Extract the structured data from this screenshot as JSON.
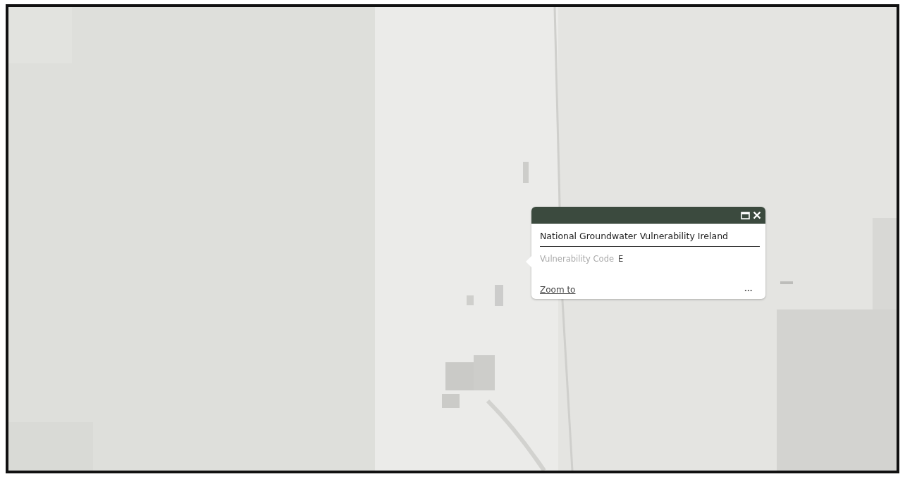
{
  "popup": {
    "title": "National Groundwater Vulnerability Ireland",
    "fields": [
      {
        "label": "Vulnerability Code",
        "value": "E"
      }
    ],
    "action": "Zoom to",
    "more": "•••"
  }
}
